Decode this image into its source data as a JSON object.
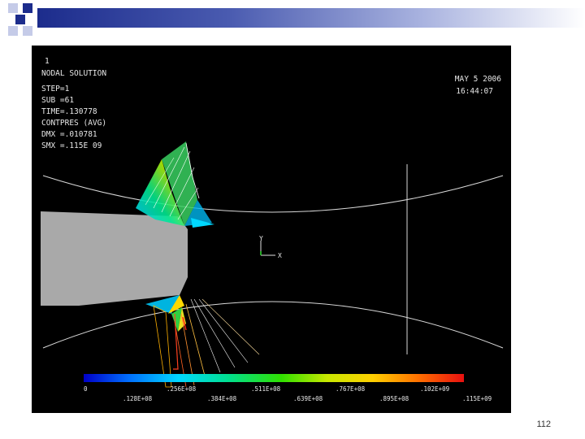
{
  "header": {
    "title": "NODAL SOLUTION",
    "lines": [
      "STEP=1",
      "SUB =61",
      "TIME=.130778",
      "CONTPRES (AVG)",
      "DMX =.010781",
      "SMX =.115E 09"
    ],
    "date": "MAY  5 2006",
    "time": "16:44:07",
    "window_number": "1"
  },
  "axes_triad": {
    "y_label": "Y",
    "x_label": "X"
  },
  "legend": {
    "values_top": [
      "0",
      ".256E+08",
      ".511E+08",
      ".767E+08",
      ".102E+09"
    ],
    "values_bottom": [
      ".128E+08",
      ".384E+08",
      ".639E+08",
      ".895E+08",
      ".115E+09"
    ]
  },
  "slide": {
    "number": "112"
  },
  "colors": {
    "viewport_bg": "#000000",
    "workpiece": "#a9a9a9",
    "deco_blue": "#1c2c8c",
    "deco_light": "#c5cbe8"
  }
}
